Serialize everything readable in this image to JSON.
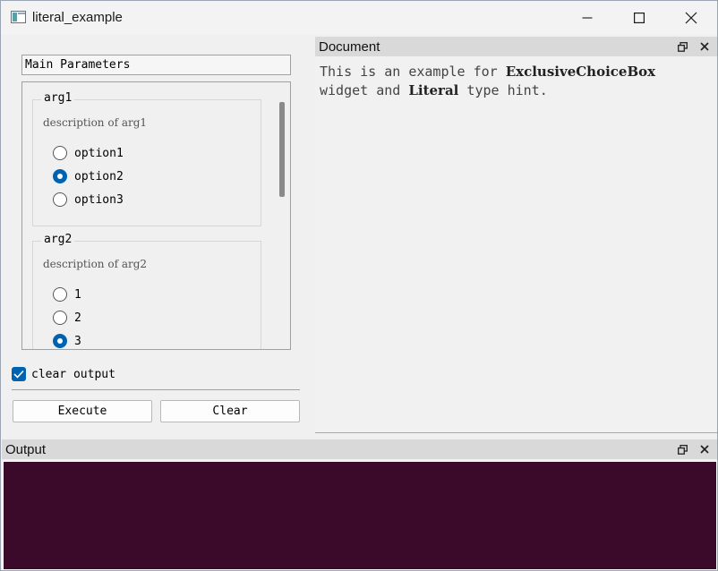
{
  "window": {
    "title": "literal_example"
  },
  "left": {
    "section_title": "Main Parameters",
    "groups": [
      {
        "title": "arg1",
        "description": "description of arg1",
        "options": [
          {
            "label": "option1",
            "checked": false
          },
          {
            "label": "option2",
            "checked": true
          },
          {
            "label": "option3",
            "checked": false
          }
        ]
      },
      {
        "title": "arg2",
        "description": "description of arg2",
        "options": [
          {
            "label": "1",
            "checked": false
          },
          {
            "label": "2",
            "checked": false
          },
          {
            "label": "3",
            "checked": true
          }
        ]
      }
    ],
    "clear_output": {
      "label": "clear output",
      "checked": true
    },
    "execute_label": "Execute",
    "clear_label": "Clear"
  },
  "document": {
    "title": "Document",
    "text_parts": {
      "p1": "This is an example for ",
      "b1": "ExclusiveChoiceBox",
      "p2": " widget and ",
      "b2": "Literal",
      "p3": " type hint."
    }
  },
  "output": {
    "title": "Output",
    "background": "#3b0a2a"
  },
  "colors": {
    "accent": "#0063b1"
  }
}
